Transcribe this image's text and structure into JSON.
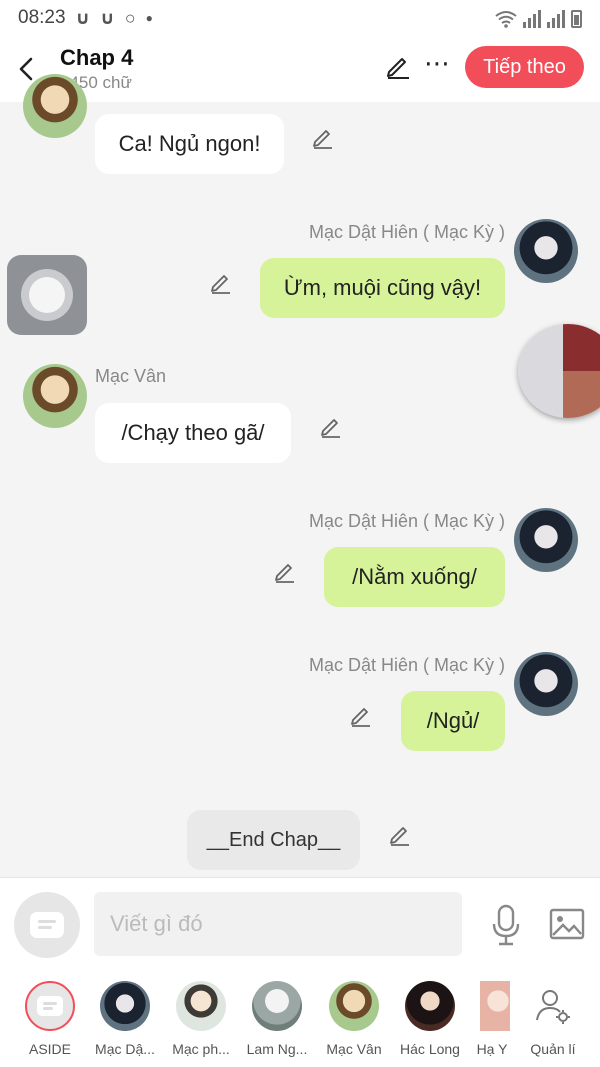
{
  "status_bar": {
    "time": "08:23",
    "icons": [
      "u-icon",
      "u-icon",
      "circle-icon",
      "dot"
    ]
  },
  "header": {
    "title": "Chap 4",
    "word_count": "1450 chữ",
    "next_label": "Tiếp theo"
  },
  "messages": [
    {
      "side": "left",
      "text": "Ca! Ngủ ngon!"
    },
    {
      "side": "right",
      "name": "Mạc Dật Hiên ( Mạc Kỳ )",
      "text": "Ừm, muội cũng vậy!"
    },
    {
      "side": "left",
      "name": "Mạc Vân",
      "text": "/Chạy theo gã/"
    },
    {
      "side": "right",
      "name": "Mạc Dật Hiên ( Mạc Kỳ )",
      "text": "/Nằm xuống/"
    },
    {
      "side": "right",
      "name": "Mạc Dật Hiên ( Mạc Kỳ )",
      "text": "/Ngủ/"
    },
    {
      "side": "center",
      "text": "__End Chap__"
    }
  ],
  "input": {
    "placeholder": "Viết gì đó"
  },
  "characters": [
    {
      "label": "ASIDE"
    },
    {
      "label": "Mạc Dậ..."
    },
    {
      "label": "Mạc ph..."
    },
    {
      "label": "Lam Ng..."
    },
    {
      "label": "Mạc Vân"
    },
    {
      "label": "Hác Long"
    },
    {
      "label": "Hạ Y"
    },
    {
      "label": "Quản lí"
    }
  ],
  "colors": {
    "accent": "#f24e5a",
    "right_bubble": "#d6f39a",
    "left_bubble": "#ffffff",
    "background": "#f4f4f4"
  }
}
